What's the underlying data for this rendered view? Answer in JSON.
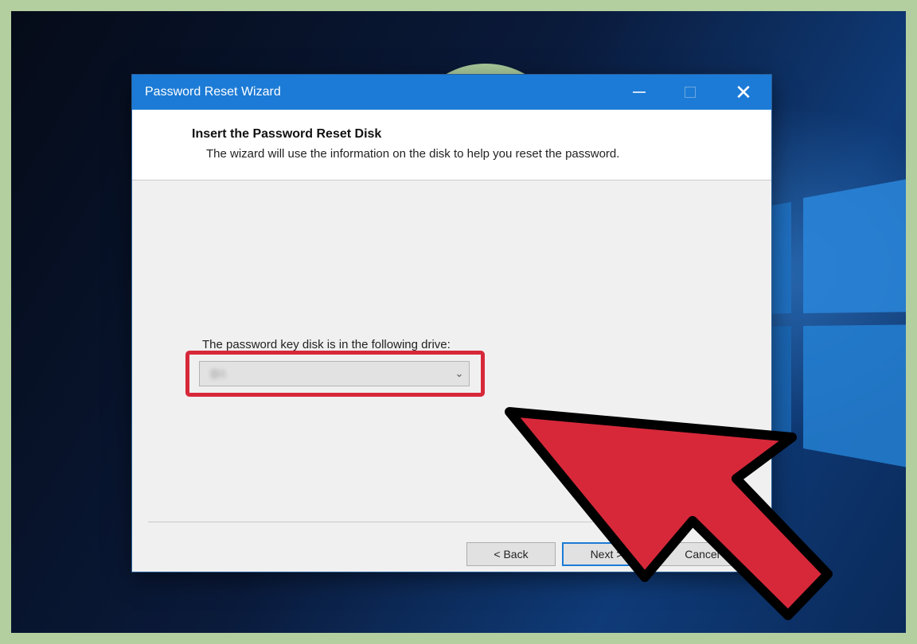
{
  "window": {
    "title": "Password Reset Wizard",
    "minimize_icon": "minimize-icon",
    "maximize_icon": "maximize-icon",
    "close_icon": "close-icon",
    "close_glyph": "✕"
  },
  "header": {
    "title": "Insert the Password Reset Disk",
    "subtitle": "The wizard will use the information on the disk to help you reset the password."
  },
  "body": {
    "drive_label": "The password key disk is in the following drive:",
    "drive_value": "D:\\",
    "drive_chevron": "⌄"
  },
  "buttons": {
    "back": "< Back",
    "next": "Next >",
    "cancel": "Cancel"
  },
  "colors": {
    "titlebar": "#1c7bd6",
    "highlight": "#d7283a",
    "arrow": "#d7283a",
    "frame": "#b3cf9f"
  }
}
